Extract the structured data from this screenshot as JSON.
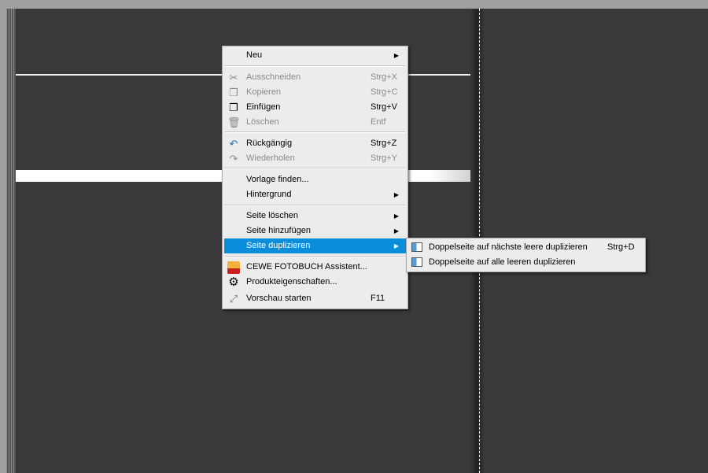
{
  "context_menu": {
    "items": [
      {
        "label": "Neu",
        "has_submenu": true
      },
      {
        "label": "Ausschneiden",
        "shortcut": "Strg+X",
        "icon": "scissors-icon",
        "disabled": true
      },
      {
        "label": "Kopieren",
        "shortcut": "Strg+C",
        "icon": "copy-icon",
        "disabled": true
      },
      {
        "label": "Einfügen",
        "shortcut": "Strg+V",
        "icon": "paste-icon"
      },
      {
        "label": "Löschen",
        "shortcut": "Entf",
        "icon": "trash-icon",
        "disabled": true
      },
      {
        "label": "Rückgängig",
        "shortcut": "Strg+Z",
        "icon": "undo-icon"
      },
      {
        "label": "Wiederholen",
        "shortcut": "Strg+Y",
        "icon": "redo-icon",
        "disabled": true
      },
      {
        "label": "Vorlage finden..."
      },
      {
        "label": "Hintergrund",
        "has_submenu": true
      },
      {
        "label": "Seite löschen",
        "has_submenu": true
      },
      {
        "label": "Seite hinzufügen",
        "has_submenu": true
      },
      {
        "label": "Seite duplizieren",
        "has_submenu": true,
        "highlighted": true
      },
      {
        "label": "CEWE FOTOBUCH Assistent...",
        "icon": "assistant-avatar-icon"
      },
      {
        "label": "Produkteigenschaften...",
        "icon": "gear-icon"
      },
      {
        "label": "Vorschau starten",
        "shortcut": "F11",
        "icon": "fullscreen-icon"
      }
    ]
  },
  "submenu": {
    "items": [
      {
        "label": "Doppelseite auf nächste leere duplizieren",
        "shortcut": "Strg+D",
        "icon": "duplicate-page-icon"
      },
      {
        "label": "Doppelseite auf alle leeren duplizieren",
        "icon": "duplicate-all-pages-icon"
      }
    ]
  },
  "colors": {
    "highlight": "#0a8ddb",
    "canvas": "#3a383b",
    "menu": "#ececec"
  }
}
